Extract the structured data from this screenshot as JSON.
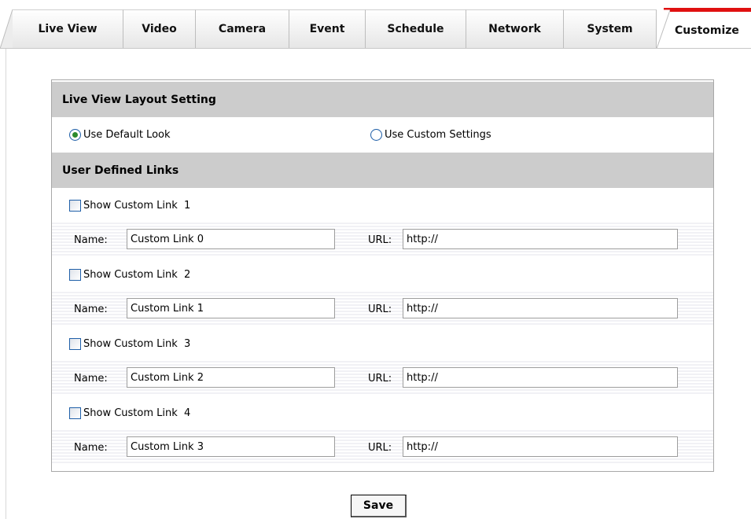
{
  "tabs": [
    {
      "label": "Live View",
      "active": false
    },
    {
      "label": "Video",
      "active": false
    },
    {
      "label": "Camera",
      "active": false
    },
    {
      "label": "Event",
      "active": false
    },
    {
      "label": "Schedule",
      "active": false
    },
    {
      "label": "Network",
      "active": false
    },
    {
      "label": "System",
      "active": false
    },
    {
      "label": "Customize",
      "active": true
    }
  ],
  "colors": {
    "active_tab_accent": "#e01010",
    "section_header_bg": "#cccccc",
    "radio_selected": "#2c8a2c"
  },
  "layout_section": {
    "title": "Live View Layout Setting",
    "options": [
      {
        "label": "Use Default Look",
        "selected": true
      },
      {
        "label": "Use Custom Settings",
        "selected": false
      }
    ]
  },
  "links_section": {
    "title": "User Defined Links",
    "name_label": "Name:",
    "url_label": "URL:",
    "links": [
      {
        "show_label": "Show Custom Link  1",
        "checked": false,
        "name": "Custom Link 0",
        "url": "http://"
      },
      {
        "show_label": "Show Custom Link  2",
        "checked": false,
        "name": "Custom Link 1",
        "url": "http://"
      },
      {
        "show_label": "Show Custom Link  3",
        "checked": false,
        "name": "Custom Link 2",
        "url": "http://"
      },
      {
        "show_label": "Show Custom Link  4",
        "checked": false,
        "name": "Custom Link 3",
        "url": "http://"
      }
    ]
  },
  "save_label": "Save"
}
